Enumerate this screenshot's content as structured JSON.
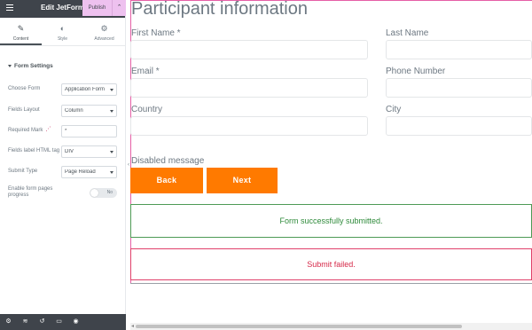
{
  "panel": {
    "title": "Edit JetForm",
    "tabs": [
      {
        "label": "Content",
        "icon": "pencil-icon"
      },
      {
        "label": "Style",
        "icon": "half-circle-icon"
      },
      {
        "label": "Advanced",
        "icon": "gear-icon"
      }
    ],
    "section_title": "Form Settings",
    "controls": {
      "form_label": "Choose Form",
      "form_value": "Application Form",
      "layout_label": "Fields Layout",
      "layout_value": "Column",
      "required_label": "Required Mark",
      "required_value": "*",
      "tag_label": "Fields label HTML tag",
      "tag_value": "DIV",
      "submit_label": "Submit Type",
      "submit_value": "Page Reload",
      "progress_label": "Enable form pages progress",
      "progress_toggle": "No"
    },
    "footer": {
      "publish_label": "Publish"
    }
  },
  "form": {
    "title": "Participant information",
    "fields": {
      "first_name": "First Name *",
      "last_name": "Last Name",
      "email": "Email *",
      "phone": "Phone Number",
      "country": "Country",
      "city": "City"
    },
    "disabled_message": "Disabled message",
    "back_label": "Back",
    "next_label": "Next",
    "success_message": "Form successfully submitted.",
    "fail_message": "Submit failed."
  },
  "colors": {
    "accent": "#ff7a00",
    "panel_dark": "#3f444b",
    "success": "#2e8a3a",
    "error": "#d62a4a",
    "publish_bg": "#eec1ef"
  }
}
